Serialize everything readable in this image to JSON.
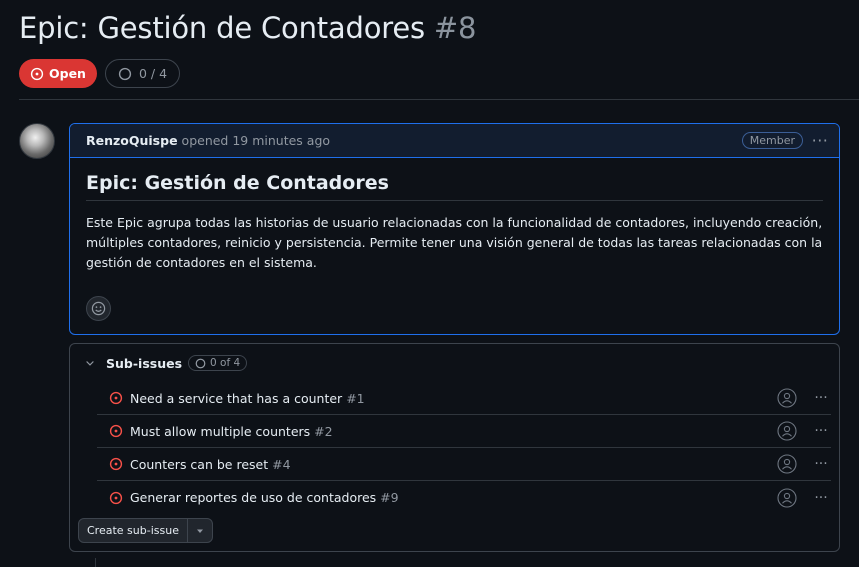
{
  "issue": {
    "title": "Epic: Gestión de Contadores",
    "number": "#8",
    "state": "Open",
    "progress": "0 / 4"
  },
  "comment": {
    "author": "RenzoQuispe",
    "meta": "opened 19 minutes ago",
    "role_badge": "Member",
    "heading": "Epic: Gestión de Contadores",
    "body": "Este Epic agrupa todas las historias de usuario relacionadas con la funcionalidad de contadores, incluyendo creación, múltiples contadores, reinicio y persistencia. Permite tener una visión general de todas las tareas relacionadas con la gestión de contadores en el sistema."
  },
  "subissues": {
    "label": "Sub-issues",
    "count": "0 of 4",
    "items": [
      {
        "title": "Need a service that has a counter",
        "number": "#1"
      },
      {
        "title": "Must allow multiple counters",
        "number": "#2"
      },
      {
        "title": "Counters can be reset",
        "number": "#4"
      },
      {
        "title": "Generar reportes de uso de contadores",
        "number": "#9"
      }
    ],
    "create_label": "Create sub-issue"
  },
  "colors": {
    "open_red": "#da3633",
    "accent_blue": "#1f6feb",
    "background": "#0d1117"
  }
}
